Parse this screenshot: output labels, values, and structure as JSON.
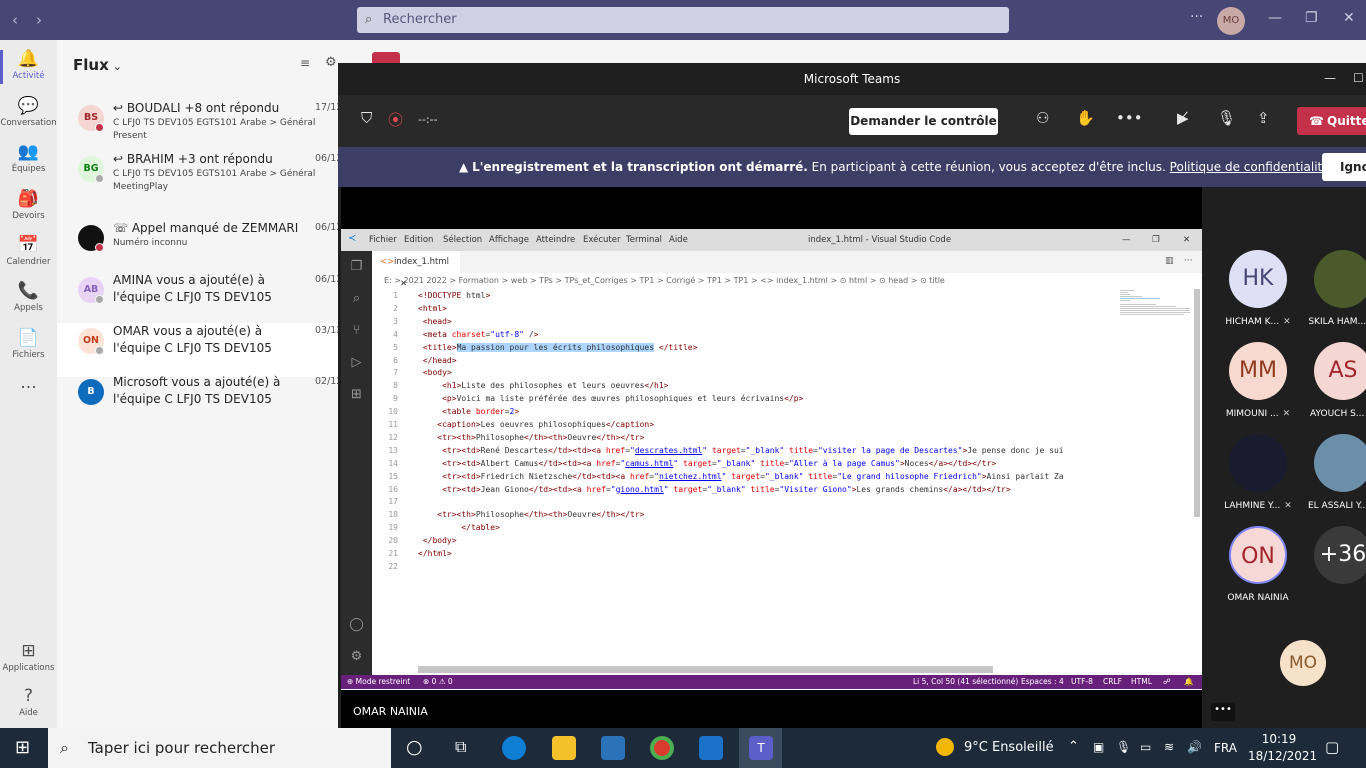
{
  "teams": {
    "search_placeholder": "Rechercher",
    "more": "···",
    "user_initials": "MO",
    "rail": [
      {
        "label": "Activité",
        "glyph": "🔔"
      },
      {
        "label": "Conversation",
        "glyph": "💬"
      },
      {
        "label": "Équipes",
        "glyph": "👥"
      },
      {
        "label": "Devoirs",
        "glyph": "🎒"
      },
      {
        "label": "Calendrier",
        "glyph": "📅"
      },
      {
        "label": "Appels",
        "glyph": "📞"
      },
      {
        "label": "Fichiers",
        "glyph": "📄"
      },
      {
        "label": "",
        "glyph": "···"
      },
      {
        "label": "Applications",
        "glyph": "⊞"
      },
      {
        "label": "Aide",
        "glyph": "?"
      }
    ],
    "feed_title": "Flux",
    "feed": [
      {
        "initials": "BS",
        "title": "↩ BOUDALI +8 ont répondu",
        "sub": "C LFJ0 TS DEV105 EGTS101 Arabe > Général",
        "sub2": "Present",
        "date": "17/12"
      },
      {
        "initials": "BG",
        "title": "↩ BRAHIM +3 ont répondu",
        "sub": "C LFJ0 TS DEV105 EGTS101 Arabe > Général",
        "sub2": "MeetingPlay",
        "date": "06/12"
      },
      {
        "initials": "",
        "title": "☏ Appel manqué de ZEMMARI",
        "sub": "Numéro inconnu",
        "sub2": "",
        "date": "06/12"
      },
      {
        "initials": "AB",
        "title": "AMINA vous a ajouté(e) à l'équipe C LFJ0 TS DEV105 EGTS10...",
        "sub": "",
        "sub2": "",
        "date": "06/12"
      },
      {
        "initials": "ON",
        "title": "OMAR vous a ajouté(e) à l'équipe C LFJ0 TS DEV105 M103...",
        "sub": "",
        "sub2": "",
        "date": "03/12"
      },
      {
        "initials": "B",
        "title": "Microsoft vous a ajouté(e) à l'équipe C LFJ0 TS DEV105 EGTSA1...",
        "sub": "",
        "sub2": "",
        "date": "02/12"
      }
    ],
    "channel_name": "Général"
  },
  "meeting": {
    "window_title": "Microsoft Teams",
    "timer": "--:--",
    "request_control": "Demander le contrôle",
    "quit": "Quitter",
    "notice_bold": "L'enregistrement et la transcription ont démarré.",
    "notice": " En participant à cette réunion, vous acceptez d'être inclus. ",
    "notice_link": "Politique de confidentialité",
    "ignore": "Ignorer",
    "presenter": "OMAR NAINIA",
    "participants": [
      {
        "initials": "HK",
        "name": "HICHAM K...",
        "color": "#dfe0f5",
        "fg": "#464775",
        "muted": true
      },
      {
        "initials": "",
        "name": "SKILA HAM...",
        "color": "#4a5a2a",
        "fg": "#fff",
        "muted": true
      },
      {
        "initials": "MM",
        "name": "MIMOUNI ...",
        "color": "#f7d9cf",
        "fg": "#8e3a1f",
        "muted": true
      },
      {
        "initials": "AS",
        "name": "AYOUCH S...",
        "color": "#f4d6d2",
        "fg": "#a4262c",
        "muted": true
      },
      {
        "initials": "",
        "name": "LAHMINE Y...",
        "color": "#1b1b2f",
        "fg": "#fff",
        "muted": true
      },
      {
        "initials": "",
        "name": "EL ASSALI Y...",
        "color": "#6b8fa8",
        "fg": "#fff",
        "muted": true
      },
      {
        "initials": "ON",
        "name": "OMAR NAINIA",
        "color": "#f6d9d6",
        "fg": "#a4262c",
        "muted": false
      },
      {
        "initials": "+36",
        "name": "",
        "color": "#3a3a3a",
        "fg": "#fff",
        "muted": false
      }
    ],
    "self_initials": "MO"
  },
  "vscode": {
    "menu": [
      "Fichier",
      "Edition",
      "Sélection",
      "Affichage",
      "Atteindre",
      "Exécuter",
      "Terminal",
      "Aide"
    ],
    "title": "index_1.html - Visual Studio Code",
    "tab": "index_1.html",
    "breadcrumb": "E: > 2021 2022 > Formation > web > TPs > TPs_et_Corriges > TP1 > Corrigé > TP1 > TP1 > <> index_1.html > ⊙ html > ⊙ head > ⊙ title",
    "status_left": "⊕ Mode restreint",
    "status_errors": "⊗ 0 ⚠ 0",
    "status_pos": "Li 5, Col 50 (41 sélectionné)",
    "status_spaces": "Espaces : 4",
    "status_enc": "UTF-8",
    "status_eol": "CRLF",
    "status_lang": "HTML",
    "code": [
      "<!DOCTYPE html>",
      "<html>",
      " <head>",
      " <meta charset=\"utf-8\" />",
      " <title>Ma passion pour les écrits philosophiques </title>",
      " </head>",
      " <body>",
      "     <h1>Liste des philosophes et leurs oeuvres</h1>",
      "     <p>Voici ma liste préférée des œuvres philosophiques et leurs écrivains</p>",
      "     <table border=2>",
      "    <caption>Les oeuvres philosophiques</caption>",
      "    <tr><th>Philosophe</th><th>Oeuvre</th></tr>",
      "     <tr><td>René Descartes</td><td><a href=\"descrates.html\" target=\"_blank\" title=\"visiter la page de Descartes\">Je pense donc je sui",
      "     <tr><td>Albert Camus</td><td><a href=\"camus.html\" target=\"_blank\" title=\"Aller à la page Camus\">Noces</a></td></tr>",
      "     <tr><td>Friedrich Nietzsche</td><td><a href=\"nietchez.html\" target=\"_blank\" title=\"Le grand hilosophe Friedrich\">Ainsi parlait Za",
      "     <tr><td>Jean Giono</td><td><a href=\"giono.html\" target=\"_blank\" title=\"Visiter Giono\">Les grands chemins</a></td></tr>",
      "",
      "    <tr><th>Philosophe</th><th>Oeuvre</th></tr>",
      "         </table>",
      " </body>",
      "</html>",
      ""
    ]
  },
  "taskbar": {
    "search": "Taper ici pour rechercher",
    "weather": "9°C  Ensoleillé",
    "lang": "FRA",
    "time": "10:19",
    "date": "18/12/2021"
  }
}
